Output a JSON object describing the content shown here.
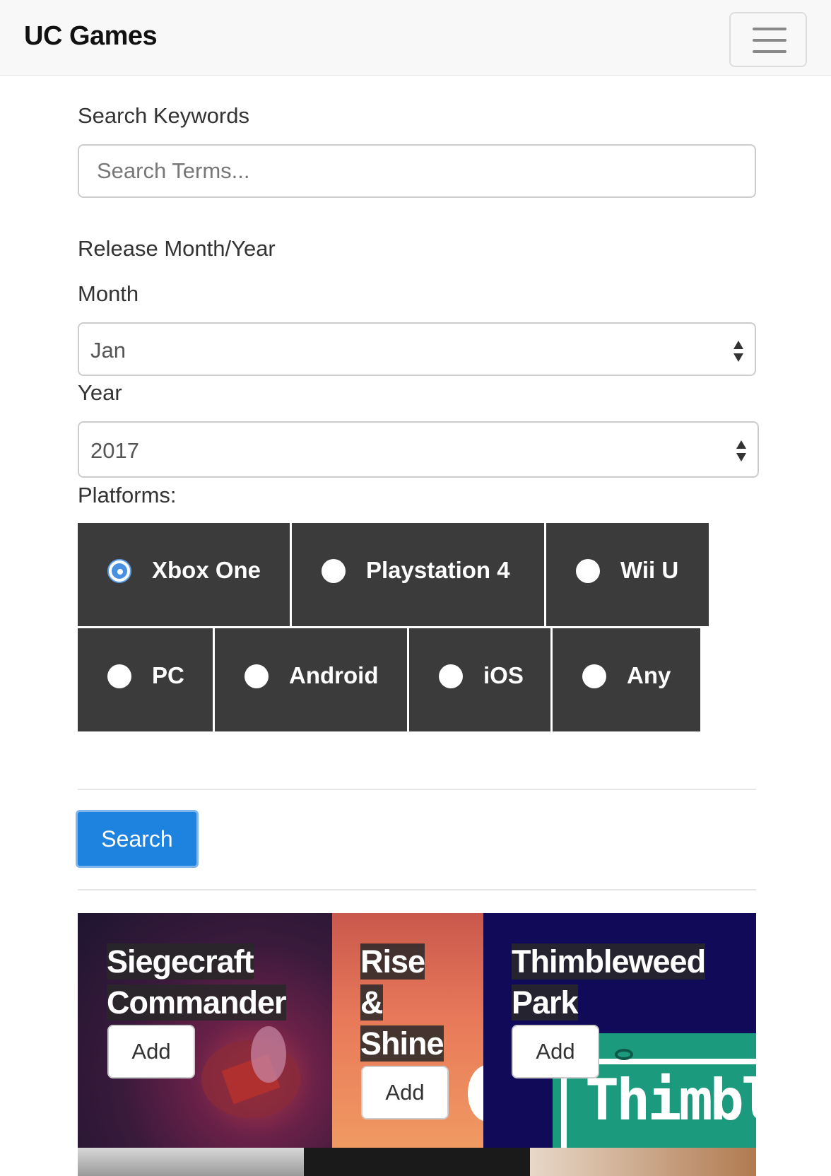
{
  "navbar": {
    "brand": "UC Games",
    "menu_icon": "hamburger-menu-icon"
  },
  "search": {
    "keywords_label": "Search Keywords",
    "placeholder": "Search Terms...",
    "value": ""
  },
  "release": {
    "heading": "Release Month/Year",
    "month_label": "Month",
    "month_value": "Jan",
    "year_label": "Year",
    "year_value": "2017",
    "select_icon": "updown-arrows-icon"
  },
  "platforms": {
    "label": "Platforms:",
    "options": [
      {
        "label": "Xbox One",
        "selected": true
      },
      {
        "label": "Playstation 4",
        "selected": false
      },
      {
        "label": "Wii U",
        "selected": false
      },
      {
        "label": "PC",
        "selected": false
      },
      {
        "label": "Android",
        "selected": false
      },
      {
        "label": "iOS",
        "selected": false
      },
      {
        "label": "Any",
        "selected": false
      }
    ]
  },
  "search_button": "Search",
  "games": [
    {
      "title_lines": [
        "Siegecraft",
        "Commander"
      ],
      "add_label": "Add"
    },
    {
      "title_lines": [
        "Rise",
        "&",
        "Shine"
      ],
      "add_label": "Add"
    },
    {
      "title_lines": [
        "Thimbleweed",
        "Park"
      ],
      "add_label": "Add",
      "art_text": "Thimbl"
    }
  ],
  "colors": {
    "navbar_bg": "#f8f8f8",
    "platform_bg": "#3b3b3b",
    "primary": "#1e83de",
    "radio_selected": "#4a90e2"
  }
}
